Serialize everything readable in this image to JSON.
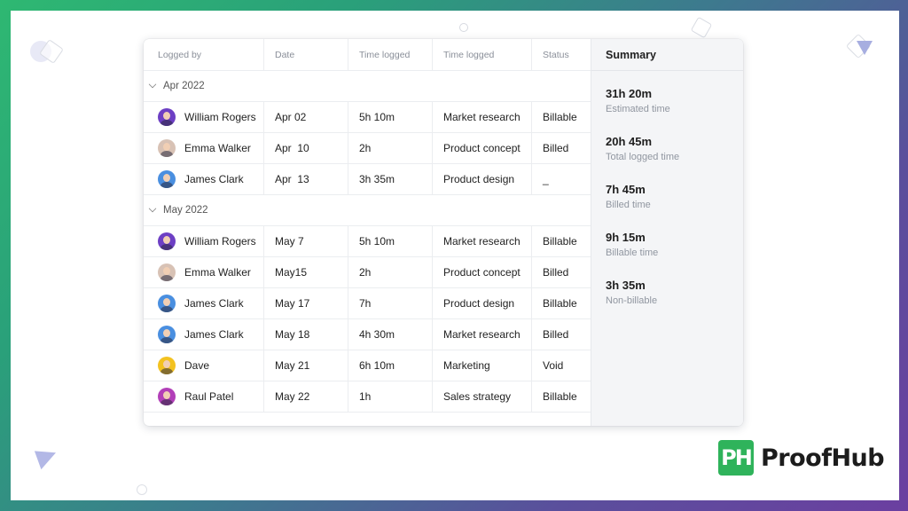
{
  "table": {
    "headers": [
      "Logged by",
      "Date",
      "Time logged",
      "Time logged",
      "Status"
    ],
    "groups": [
      {
        "label": "Apr 2022",
        "rows": [
          {
            "name": "William Rogers",
            "date": "Apr 02",
            "time": "5h 10m",
            "task": "Market research",
            "status": "Billable"
          },
          {
            "name": "Emma Walker",
            "date": "Apr  10",
            "time": "2h",
            "task": "Product concept",
            "status": "Billed"
          },
          {
            "name": "James Clark",
            "date": "Apr  13",
            "time": "3h 35m",
            "task": "Product design",
            "status": "_"
          }
        ]
      },
      {
        "label": "May 2022",
        "rows": [
          {
            "name": "William Rogers",
            "date": "May 7",
            "time": "5h 10m",
            "task": "Market research",
            "status": "Billable"
          },
          {
            "name": "Emma Walker",
            "date": "May15",
            "time": "2h",
            "task": "Product concept",
            "status": "Billed"
          },
          {
            "name": "James Clark",
            "date": "May 17",
            "time": "7h",
            "task": "Product design",
            "status": "Billable"
          },
          {
            "name": "James Clark",
            "date": "May 18",
            "time": "4h 30m",
            "task": "Market research",
            "status": "Billed"
          },
          {
            "name": "Dave",
            "date": "May 21",
            "time": "6h 10m",
            "task": "Marketing",
            "status": "Void"
          },
          {
            "name": "Raul Patel",
            "date": "May 22",
            "time": "1h",
            "task": "Sales strategy",
            "status": "Billable"
          }
        ]
      }
    ]
  },
  "summary": {
    "title": "Summary",
    "items": [
      {
        "value": "31h 20m",
        "label": "Estimated time"
      },
      {
        "value": "20h 45m",
        "label": "Total logged time"
      },
      {
        "value": "7h 45m",
        "label": "Billed time"
      },
      {
        "value": "9h 15m",
        "label": "Billable time"
      },
      {
        "value": "3h 35m",
        "label": "Non-billable"
      }
    ]
  },
  "brand": {
    "logo_text": "PH",
    "name": "ProofHub",
    "color": "#2fb35b"
  },
  "avatar_colors": {
    "William Rogers": "#6d3fc4",
    "Emma Walker": "#d8c2b5",
    "James Clark": "#4a8fe0",
    "Dave": "#f3c220",
    "Raul Patel": "#b23fb8"
  }
}
